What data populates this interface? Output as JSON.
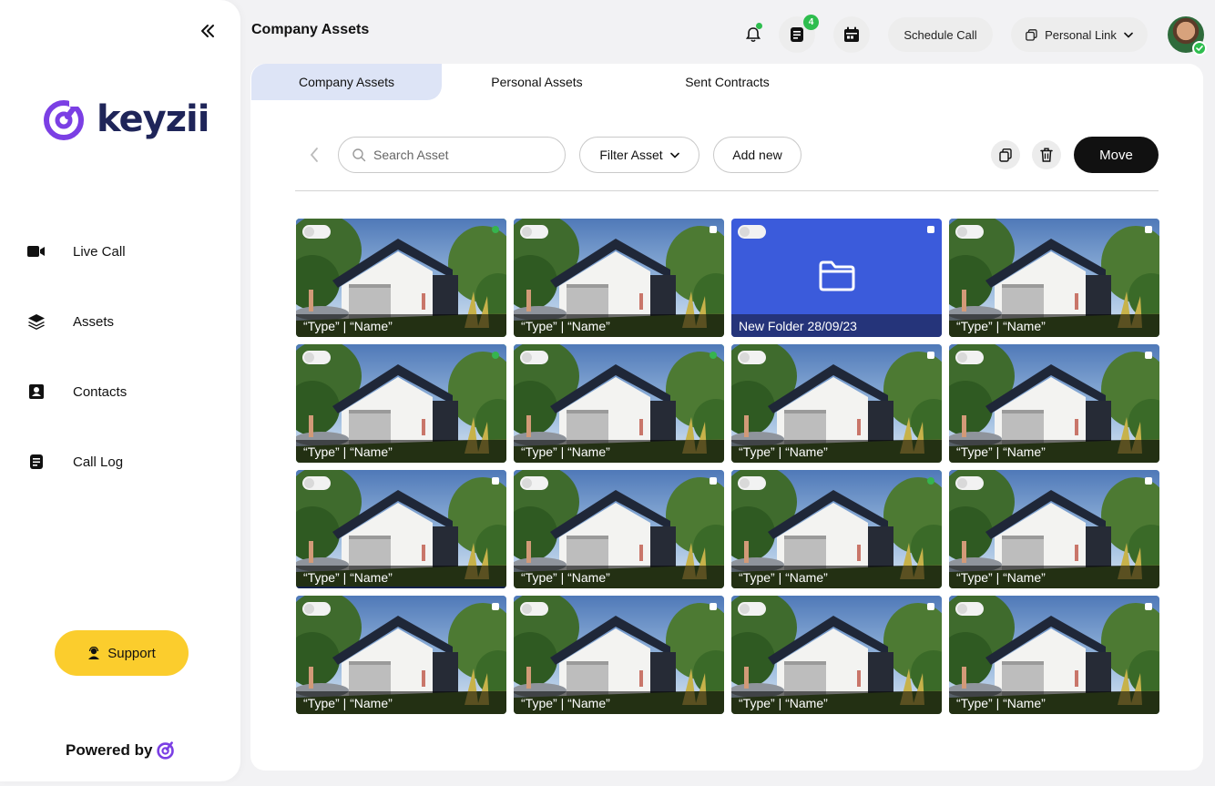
{
  "sidebar": {
    "brand": "keyzii",
    "items": [
      {
        "label": "Live Call",
        "icon": "video-camera-icon"
      },
      {
        "label": "Assets",
        "icon": "layers-icon"
      },
      {
        "label": "Contacts",
        "icon": "contact-card-icon"
      },
      {
        "label": "Call Log",
        "icon": "document-icon"
      }
    ],
    "support_label": "Support",
    "powered_by": "Powered by"
  },
  "header": {
    "title": "Company Assets",
    "messages_count": "4",
    "schedule_call": "Schedule Call",
    "personal_link": "Personal Link"
  },
  "tabs": [
    {
      "label": "Company Assets",
      "active": true
    },
    {
      "label": "Personal Assets",
      "active": false
    },
    {
      "label": "Sent Contracts",
      "active": false
    }
  ],
  "toolbar": {
    "search_placeholder": "Search Asset",
    "filter_label": "Filter Asset",
    "add_new_label": "Add new",
    "move_label": "Move"
  },
  "assets": [
    {
      "kind": "image",
      "caption": "“Type” | “Name”",
      "selected": true
    },
    {
      "kind": "image",
      "caption": "“Type” | “Name”",
      "selected": false
    },
    {
      "kind": "folder",
      "caption": "New Folder  28/09/23",
      "selected": false
    },
    {
      "kind": "image",
      "caption": "“Type” | “Name”",
      "selected": false
    },
    {
      "kind": "image",
      "caption": "“Type” | “Name”",
      "selected": true
    },
    {
      "kind": "image",
      "caption": "“Type” | “Name”",
      "selected": true
    },
    {
      "kind": "image",
      "caption": "“Type” | “Name”",
      "selected": false
    },
    {
      "kind": "image",
      "caption": "“Type” | “Name”",
      "selected": false
    },
    {
      "kind": "image",
      "caption": "“Type” | “Name”",
      "selected": false,
      "hovered": true
    },
    {
      "kind": "image",
      "caption": "“Type” | “Name”",
      "selected": false
    },
    {
      "kind": "image",
      "caption": "“Type” | “Name”",
      "selected": true
    },
    {
      "kind": "image",
      "caption": "“Type” | “Name”",
      "selected": false
    },
    {
      "kind": "image",
      "caption": "“Type” | “Name”",
      "selected": false
    },
    {
      "kind": "image",
      "caption": "“Type” | “Name”",
      "selected": false
    },
    {
      "kind": "image",
      "caption": "“Type” | “Name”",
      "selected": false
    },
    {
      "kind": "image",
      "caption": "“Type” | “Name”",
      "selected": false
    }
  ],
  "colors": {
    "accent": "#111111",
    "selected": "#36b44e",
    "folder": "#3b5bdb",
    "support": "#fbcd2d",
    "tab_active": "#dde4f6",
    "brand_purple": "#7b3fe4",
    "brand_navy": "#1f2559"
  }
}
